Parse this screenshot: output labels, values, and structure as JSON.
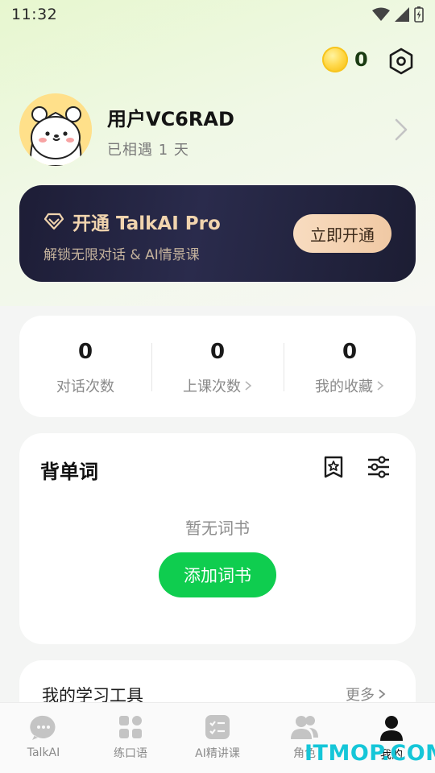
{
  "status_bar": {
    "time": "11:32"
  },
  "header": {
    "coin_count": "0"
  },
  "profile": {
    "username": "用户VC6RAD",
    "days_met": "已相遇 1 天"
  },
  "pro_banner": {
    "title": "开通 TalkAI Pro",
    "subtitle": "解锁无限对话 & AI情景课",
    "button": "立即开通",
    "accent": "#f1d4ae"
  },
  "stats": [
    {
      "value": "0",
      "label": "对话次数"
    },
    {
      "value": "0",
      "label": "上课次数"
    },
    {
      "value": "0",
      "label": "我的收藏"
    }
  ],
  "vocab": {
    "title": "背单词",
    "empty_text": "暂无词书",
    "add_button": "添加词书",
    "accent": "#0fcd4f"
  },
  "tools": {
    "title": "我的学习工具",
    "more": "更多"
  },
  "tabs": [
    {
      "label": "TalkAI",
      "icon": "chat-bubble-icon"
    },
    {
      "label": "练口语",
      "icon": "grid-icon"
    },
    {
      "label": "AI精讲课",
      "icon": "checklist-icon"
    },
    {
      "label": "角色",
      "icon": "people-icon"
    },
    {
      "label": "我的",
      "icon": "person-icon",
      "active": true
    }
  ],
  "watermark": "ITMOP.COM"
}
